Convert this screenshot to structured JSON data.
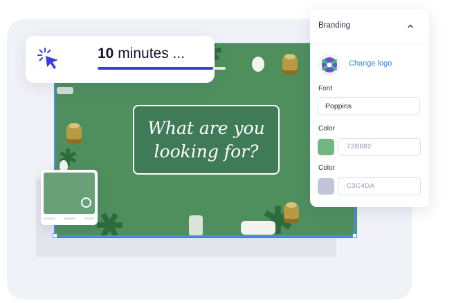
{
  "progress": {
    "value_bold": "10",
    "value_rest": " minutes ...",
    "fraction": 0.9
  },
  "headline": {
    "line1": "What are you",
    "line2": "looking for?"
  },
  "swatch_preview": {
    "codes": [
      "#6CB5F0",
      "#3B5BFF",
      "#F0D97"
    ]
  },
  "branding": {
    "title": "Branding",
    "change_logo": "Change logo",
    "font_label": "Font",
    "font_value": "Poppins",
    "color1_label": "Color",
    "color1_value": "72B682",
    "color2_label": "Color",
    "color2_value": "C3C4DA"
  },
  "colors": {
    "accent": "#3B3FD9",
    "link": "#2F7FE8",
    "swatch1": "#72B682",
    "swatch2": "#C3C4DA",
    "canvas_bg": "#4F8F5E"
  },
  "icons": {
    "progress": "cursor-click-icon",
    "panel_toggle": "chevron-up-icon",
    "logo": "brand-logo-icon"
  }
}
